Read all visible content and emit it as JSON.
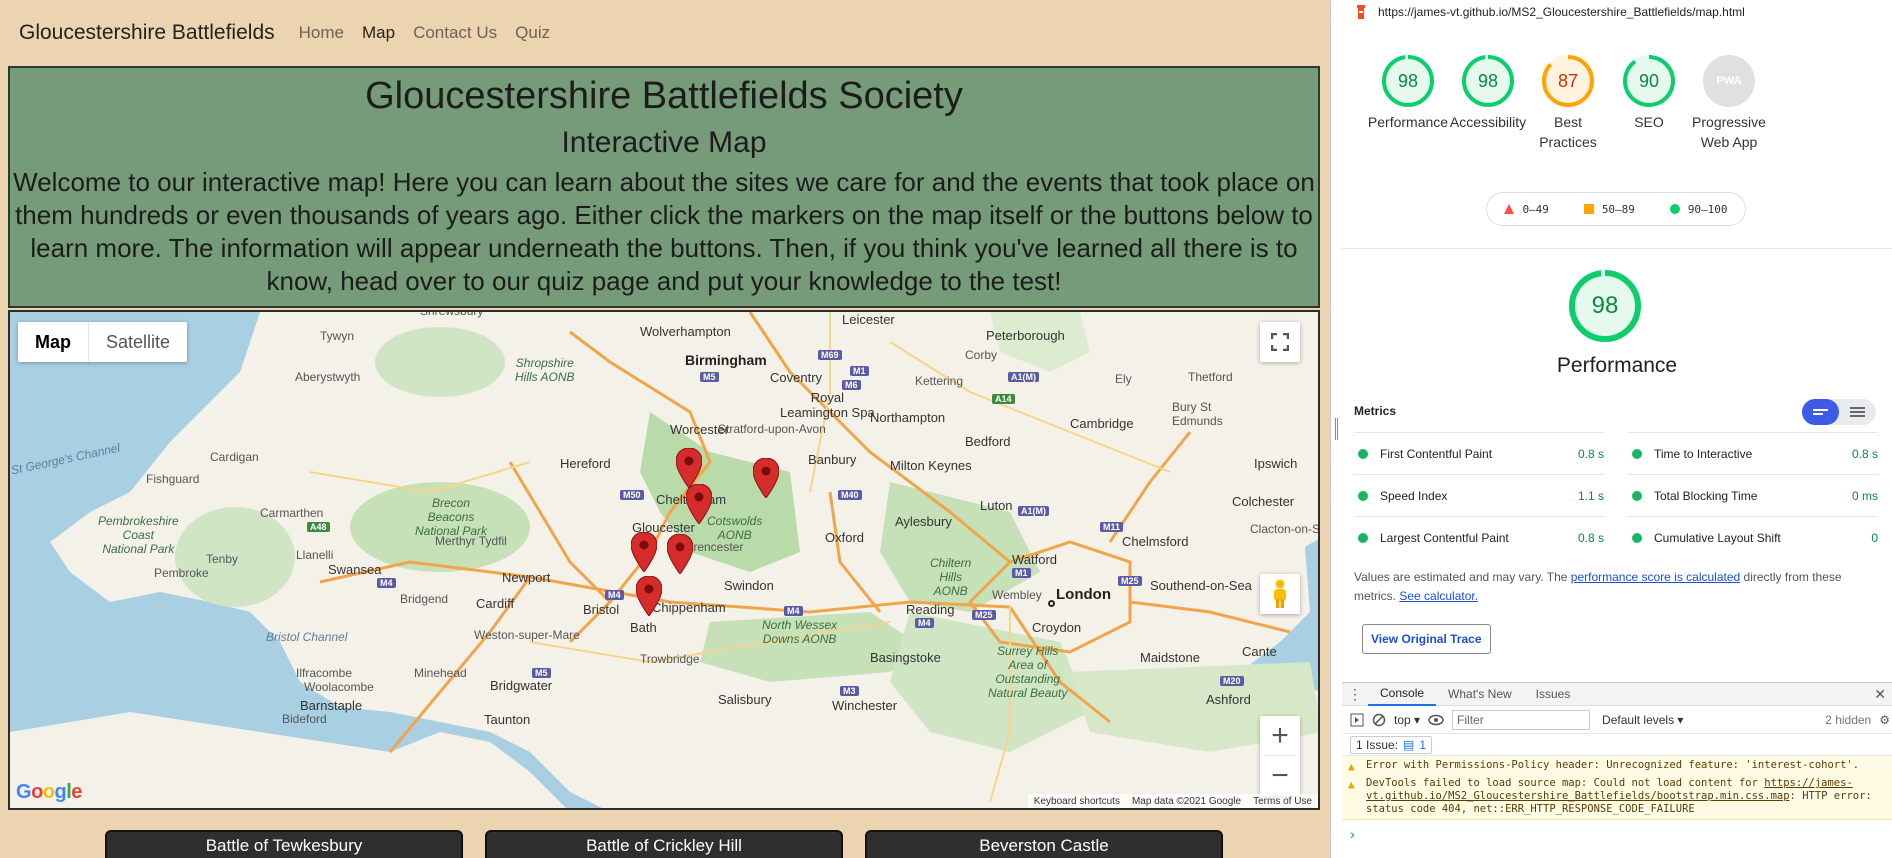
{
  "site": {
    "brand": "Gloucestershire Battlefields",
    "nav": [
      "Home",
      "Map",
      "Contact Us",
      "Quiz"
    ],
    "hero": {
      "title": "Gloucestershire Battlefields Society",
      "subtitle": "Interactive Map",
      "text": "Welcome to our interactive map! Here you can learn about the sites we care for and the events that took place on them hundreds or even thousands of years ago. Either click the markers on the map itself or the buttons below to learn more. The information will appear underneath the buttons. Then, if you think you've learned all there is to know, head over to our quiz page and put your knowledge to the test!"
    },
    "map": {
      "type_buttons": [
        "Map",
        "Satellite"
      ],
      "footer": [
        "Keyboard shortcuts",
        "Map data ©2021 Google",
        "Terms of Use"
      ],
      "logo": "Google",
      "labels": {
        "shrewsbury": "Shrewsbury",
        "wolverhampton": "Wolverhampton",
        "leicester": "Leicester",
        "peterborough": "Peterborough",
        "birmingham": "Birmingham",
        "tywyn": "Tywyn",
        "aberystwyth": "Aberystwyth",
        "shropshire": "Shropshire\nHills AONB",
        "coventry": "Coventry",
        "kettering": "Kettering",
        "corby": "Corby",
        "ely": "Ely",
        "thetford": "Thetford",
        "royal_leamington": "Royal\nLeamington Spa",
        "northampton": "Northampton",
        "bury": "Bury St\nEdmunds",
        "worcester": "Worcester",
        "stratford": "Stratford-upon-Avon",
        "bedford": "Bedford",
        "cambridge": "Cambridge",
        "stgeorges": "St George's Channel",
        "cardigan": "Cardigan",
        "hereford": "Hereford",
        "banbury": "Banbury",
        "milton_keynes": "Milton Keynes",
        "ipswich": "Ipswich",
        "fishguard": "Fishguard",
        "brecon": "Brecon\nBeacons\nNational Park",
        "cheltenham": "Cheltenham",
        "colchester": "Colchester",
        "pembrokeshire": "Pembrokeshire\nCoast\nNational Park",
        "carmarthen": "Carmarthen",
        "gloucester": "Gloucester",
        "cotswolds": "Cotswolds\nAONB",
        "aylesbury": "Aylesbury",
        "luton": "Luton",
        "merthyr": "Merthyr Tydfil",
        "cirencester": "Cirencester",
        "oxford": "Oxford",
        "chelmsford": "Chelmsford",
        "clacton": "Clacton-on-Sea",
        "llanelli": "Llanelli",
        "tenby": "Tenby",
        "watford": "Watford",
        "pembroke": "Pembroke",
        "swansea": "Swansea",
        "newport": "Newport",
        "chiltern": "Chiltern\nHills\nAONB",
        "southend": "Southend-on-Sea",
        "bridgend": "Bridgend",
        "cardiff": "Cardiff",
        "swindon": "Swindon",
        "bristol": "Bristol",
        "wembley": "Wembley",
        "london": "London",
        "chippenham": "Chippenham",
        "reading": "Reading",
        "north_wessex": "North Wessex\nDowns AONB",
        "bristol_channel": "Bristol Channel",
        "weston": "Weston-super-Mare",
        "bath": "Bath",
        "croydon": "Croydon",
        "trowbridge": "Trowbridge",
        "basingstoke": "Basingstoke",
        "surrey": "Surrey Hills\nArea of\nOutstanding\nNatural Beauty",
        "maidstone": "Maidstone",
        "ilfracombe": "Ilfracombe",
        "minehead": "Minehead",
        "woolacombe": "Woolacombe",
        "barnstaple": "Barnstaple",
        "bridgwater": "Bridgwater",
        "salisbury": "Salisbury",
        "winchester": "Winchester",
        "ashford": "Ashford",
        "bideford": "Bideford",
        "taunton": "Taunton",
        "canterbury": "Cante"
      },
      "roads": [
        "M69",
        "M1",
        "M5",
        "M6",
        "A1(M)",
        "A14",
        "M50",
        "M40",
        "A1(M)",
        "M11",
        "A48",
        "M4",
        "M4",
        "M4",
        "M25",
        "M4",
        "M25",
        "M20",
        "M5",
        "M3",
        "M1"
      ]
    },
    "location_buttons": [
      "Battle of Tewkesbury",
      "Battle of Crickley Hill",
      "Beverston Castle"
    ]
  },
  "devtools": {
    "url": "https://james-vt.github.io/MS2_Gloucestershire_Battlefields/map.html",
    "scores": [
      {
        "label": "Performance",
        "score": "98",
        "color": "#0cce6b"
      },
      {
        "label": "Accessibility",
        "score": "98",
        "color": "#0cce6b"
      },
      {
        "label": "Best\nPractices",
        "score": "87",
        "color": "#ffa400"
      },
      {
        "label": "SEO",
        "score": "90",
        "color": "#0cce6b"
      },
      {
        "label": "Progressive\nWeb App",
        "score": "PWA",
        "color": "#cccccc"
      }
    ],
    "legend": [
      "0–49",
      "50–89",
      "90–100"
    ],
    "perf_score": "98",
    "perf_title": "Performance",
    "metrics_heading": "Metrics",
    "metrics": [
      {
        "name": "First Contentful Paint",
        "value": "0.8 s"
      },
      {
        "name": "Time to Interactive",
        "value": "0.8 s"
      },
      {
        "name": "Speed Index",
        "value": "1.1 s"
      },
      {
        "name": "Total Blocking Time",
        "value": "0 ms"
      },
      {
        "name": "Largest Contentful Paint",
        "value": "0.8 s"
      },
      {
        "name": "Cumulative Layout Shift",
        "value": "0"
      }
    ],
    "note_prefix": "Values are estimated and may vary. The ",
    "note_link1": "performance score is calculated",
    "note_mid": " directly from these metrics. ",
    "note_link2": "See calculator.",
    "view_trace": "View Original Trace",
    "console_tabs": [
      "Console",
      "What's New",
      "Issues"
    ],
    "context": "top",
    "filter_placeholder": "Filter",
    "levels": "Default levels",
    "hidden": "2 hidden",
    "issues": "1 Issue:",
    "issues_count": "1",
    "messages": [
      "Error with Permissions-Policy header: Unrecognized feature: 'interest-cohort'.",
      "DevTools failed to load source map: Could not load content for "
    ],
    "msg2_link": "https://james-vt.github.io/MS2_Gloucestershire_Battlefields/bootstrap.min.css.map",
    "msg2_tail": ": HTTP error: status code 404, net::ERR_HTTP_RESPONSE_CODE_FAILURE",
    "prompt": "›"
  }
}
